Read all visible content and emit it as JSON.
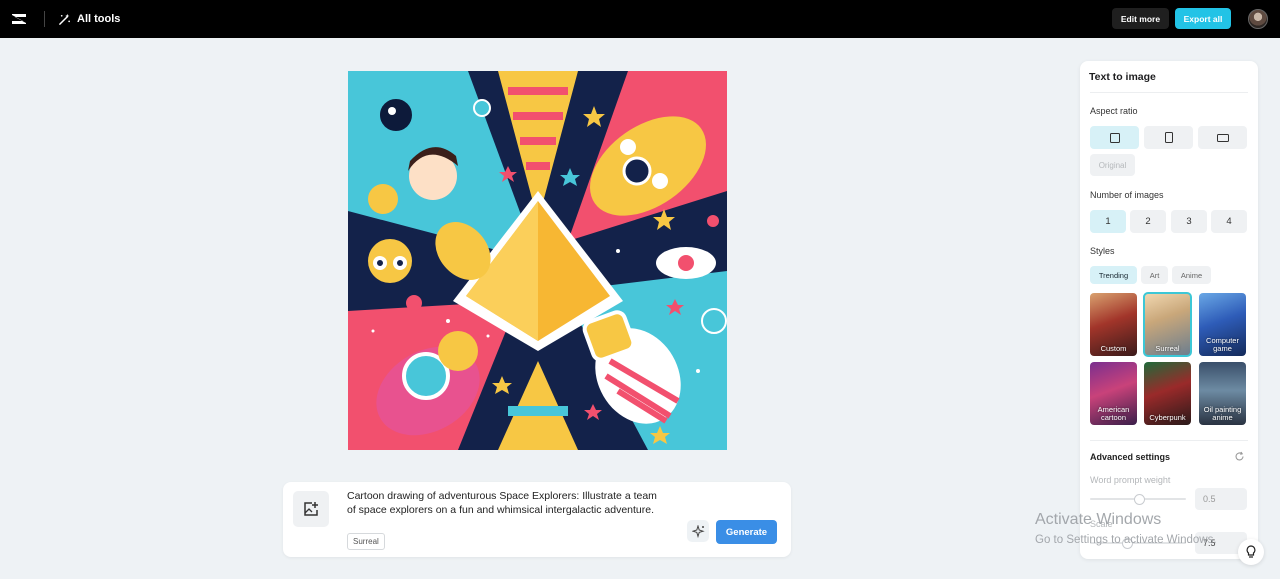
{
  "topbar": {
    "all_tools_label": "All tools",
    "edit_more_label": "Edit more",
    "export_all_label": "Export all"
  },
  "canvas": {
    "image_description_icon": "generated-image"
  },
  "prompt": {
    "text": "Cartoon drawing of adventurous Space Explorers: Illustrate a team of space explorers on a fun and whimsical intergalactic adventure.",
    "style_tag": "Surreal",
    "generate_label": "Generate"
  },
  "panel": {
    "title": "Text to image",
    "aspect_ratio": {
      "label": "Aspect ratio",
      "original_label": "Original",
      "options": [
        "square-icon",
        "portrait-icon",
        "landscape-icon"
      ],
      "selected_index": 0
    },
    "number_of_images": {
      "label": "Number of images",
      "options": [
        "1",
        "2",
        "3",
        "4"
      ],
      "selected": "1"
    },
    "styles": {
      "label": "Styles",
      "tabs": [
        "Trending",
        "Art",
        "Anime"
      ],
      "selected_tab": "Trending",
      "cards": [
        {
          "label": "Custom"
        },
        {
          "label": "Surreal"
        },
        {
          "label": "Computer game"
        },
        {
          "label": "American cartoon"
        },
        {
          "label": "Cyberpunk"
        },
        {
          "label": "Oil painting anime"
        }
      ],
      "selected_card": "Surreal"
    },
    "advanced": {
      "label": "Advanced settings",
      "word_prompt_weight_label": "Word prompt weight",
      "word_prompt_weight_value": "0.5",
      "scale_label": "Scale",
      "scale_value": "7.5"
    }
  },
  "watermark": {
    "line1": "Activate Windows",
    "line2": "Go to Settings to activate Windows."
  },
  "colors": {
    "accent": "#22c3e6",
    "generate": "#3a8ee6",
    "selected_bg": "#d7f1f7"
  }
}
